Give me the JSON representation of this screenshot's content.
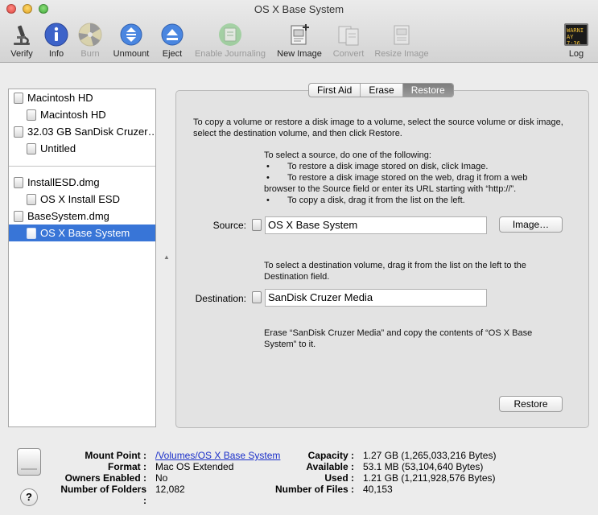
{
  "window": {
    "title": "OS X Base System"
  },
  "toolbar": {
    "verify": "Verify",
    "info": "Info",
    "burn": "Burn",
    "unmount": "Unmount",
    "eject": "Eject",
    "enable_journaling": "Enable Journaling",
    "new_image": "New Image",
    "convert": "Convert",
    "resize_image": "Resize Image",
    "log": "Log",
    "log_icon_text_1": "WARNI",
    "log_icon_text_2": "AY 7:36"
  },
  "sidebar": {
    "items": [
      {
        "label": "Macintosh HD"
      },
      {
        "label": "Macintosh HD"
      },
      {
        "label": "32.03 GB SanDisk Cruzer…"
      },
      {
        "label": "Untitled"
      },
      {
        "label": "InstallESD.dmg"
      },
      {
        "label": "OS X Install ESD"
      },
      {
        "label": "BaseSystem.dmg"
      },
      {
        "label": "OS X Base System"
      }
    ]
  },
  "tabs": {
    "first_aid": "First Aid",
    "erase": "Erase",
    "restore": "Restore"
  },
  "restore": {
    "intro": "To copy a volume or restore a disk image to a volume, select the source volume or disk image, select the destination volume, and then click Restore.",
    "source_heading": "To select a source, do one of the following:",
    "bullet_1": "To restore a disk image stored on disk, click Image.",
    "bullet_2a": "To restore a disk image stored on the web, drag it from a web",
    "bullet_2b": "browser to the Source field or enter its URL starting with “http://”.",
    "bullet_3": "To copy a disk, drag it from the list on the left.",
    "bullet_char": "•",
    "source_label": "Source:",
    "source_value": "OS X Base System",
    "image_button": "Image…",
    "dest_instructions": "To select a destination volume, drag it from the list on the left to the Destination field.",
    "destination_label": "Destination:",
    "destination_value": "SanDisk Cruzer Media",
    "erase_note": "Erase “SanDisk Cruzer Media” and copy the contents of “OS X Base System” to it.",
    "restore_button": "Restore"
  },
  "info": {
    "mount_point_label": "Mount Point :",
    "mount_point": "/Volumes/OS X Base System",
    "format_label": "Format :",
    "format": "Mac OS Extended",
    "owners_label": "Owners Enabled :",
    "owners": "No",
    "folders_label": "Number of Folders :",
    "folders": "12,082",
    "capacity_label": "Capacity :",
    "capacity": "1.27 GB (1,265,033,216 Bytes)",
    "available_label": "Available :",
    "available": "53.1 MB (53,104,640 Bytes)",
    "used_label": "Used :",
    "used": "1.21 GB (1,211,928,576 Bytes)",
    "files_label": "Number of Files :",
    "files": "40,153",
    "help": "?"
  }
}
